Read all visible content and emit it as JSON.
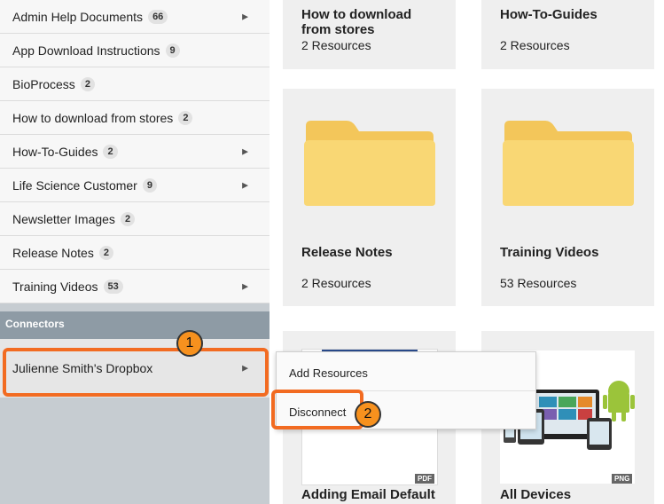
{
  "sidebar": {
    "items": [
      {
        "label": "Admin Help Documents",
        "count": "66",
        "has_chevron": true
      },
      {
        "label": "App Download Instructions",
        "count": "9",
        "has_chevron": false
      },
      {
        "label": "BioProcess",
        "count": "2",
        "has_chevron": false
      },
      {
        "label": "How to download from stores",
        "count": "2",
        "has_chevron": false
      },
      {
        "label": "How-To-Guides",
        "count": "2",
        "has_chevron": true
      },
      {
        "label": "Life Science Customer",
        "count": "9",
        "has_chevron": true
      },
      {
        "label": "Newsletter Images",
        "count": "2",
        "has_chevron": false
      },
      {
        "label": "Release Notes",
        "count": "2",
        "has_chevron": false
      },
      {
        "label": "Training Videos",
        "count": "53",
        "has_chevron": true
      }
    ],
    "connectors_header": "Connectors",
    "connector": {
      "label": "Julienne Smith's Dropbox"
    }
  },
  "cards": {
    "c1": {
      "title": "How to download from stores",
      "sub": "2 Resources"
    },
    "c2": {
      "title": "How-To-Guides",
      "sub": "2 Resources"
    },
    "c3": {
      "title": "Release Notes",
      "sub": "2 Resources"
    },
    "c4": {
      "title": "Training Videos",
      "sub": "53 Resources"
    },
    "c5": {
      "title": "Adding Email Default",
      "filetype": "PDF"
    },
    "c6": {
      "title": "All Devices",
      "filetype": "PNG"
    }
  },
  "menu": {
    "add": "Add Resources",
    "disconnect": "Disconnect"
  },
  "callouts": {
    "one": "1",
    "two": "2"
  },
  "colors": {
    "callout": "#f26b21",
    "badge": "#f7911e",
    "folder": "#f9d774",
    "connectors_bar": "#8e9ba5"
  }
}
